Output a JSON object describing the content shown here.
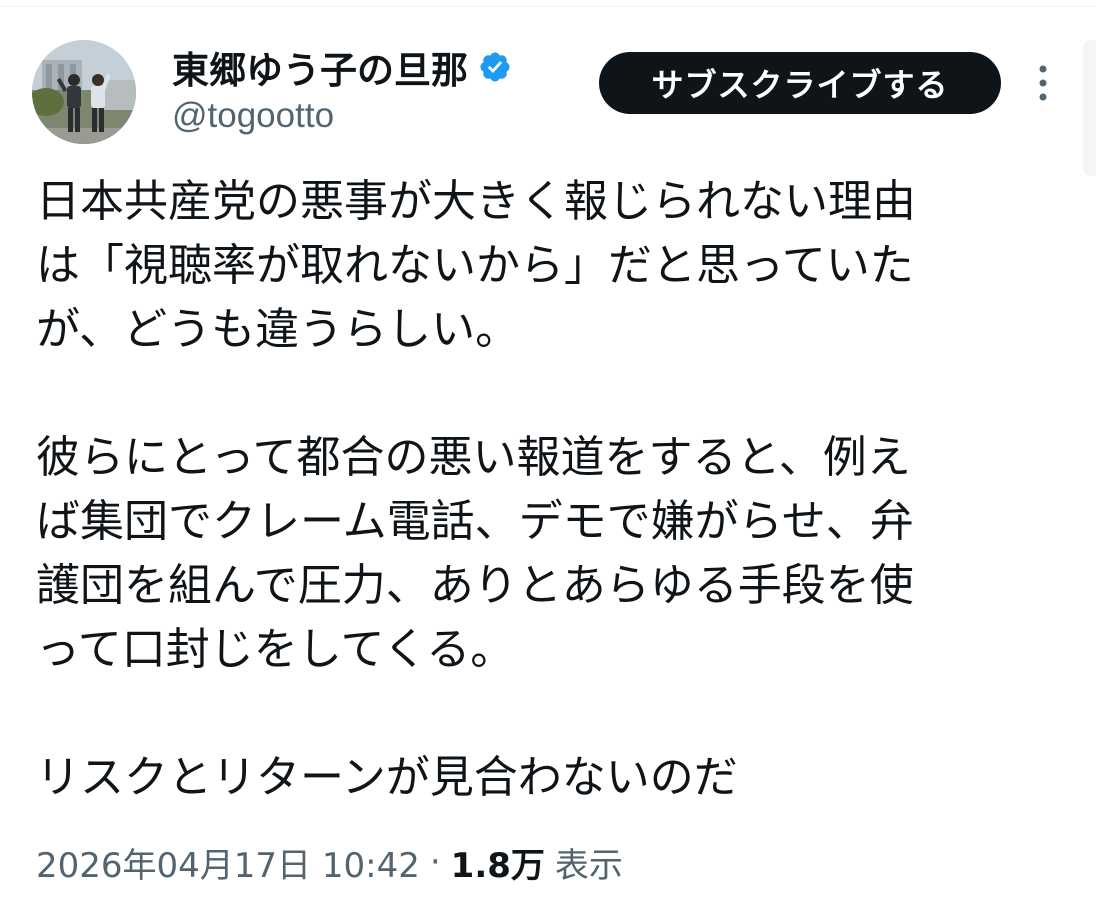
{
  "header": {
    "display_name": "東郷ゆう子の旦那",
    "handle": "@togootto",
    "subscribe_label": "サブスクライブする"
  },
  "tweet": {
    "paragraphs": [
      [
        "日本共産党の悪事が大きく報じられない理由",
        "は「視聴率が取れないから」だと思っていた",
        "が、どうも違うらしい。"
      ],
      [
        "彼らにとって都合の悪い報道をすると、例え",
        "ば集団でクレーム電話、デモで嫌がらせ、弁",
        "護団を組んで圧力、ありとあらゆる手段を使",
        "って口封じをしてくる。"
      ],
      [
        "リスクとリターンが見合わないのだ"
      ]
    ]
  },
  "meta": {
    "timestamp": "2026年04月17日 10:42",
    "separator": "·",
    "views_count": "1.8万",
    "views_label": "表示"
  },
  "icons": {
    "verified": "verified-badge-icon",
    "more": "more-vertical-icon"
  },
  "colors": {
    "verified_blue": "#1d9bf0",
    "button_bg": "#0f1419",
    "secondary_text": "#536471"
  }
}
